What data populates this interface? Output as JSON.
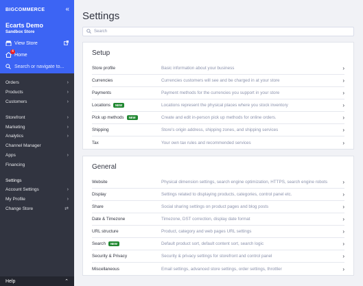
{
  "sidebar": {
    "brand": "BIGCOMMERCE",
    "store_name": "Ecarts Demo",
    "store_sub": "Sandbox Store",
    "view_store": "View Store",
    "home": "Home",
    "home_badge": "4",
    "search_placeholder": "Search or navigate to...",
    "nav": [
      {
        "label": "Orders"
      },
      {
        "label": "Products"
      },
      {
        "label": "Customers"
      },
      {
        "label": "Storefront"
      },
      {
        "label": "Marketing"
      },
      {
        "label": "Analytics"
      },
      {
        "label": "Channel Manager"
      },
      {
        "label": "Apps"
      },
      {
        "label": "Financing"
      },
      {
        "label": "Settings"
      },
      {
        "label": "Account Settings"
      },
      {
        "label": "My Profile"
      },
      {
        "label": "Change Store"
      }
    ],
    "help": "Help"
  },
  "main": {
    "title": "Settings",
    "search_placeholder": "Search",
    "setup": {
      "title": "Setup",
      "rows": [
        {
          "label": "Store profile",
          "desc": "Basic information about your business"
        },
        {
          "label": "Currencies",
          "desc": "Currencies customers will see and be charged in at your store"
        },
        {
          "label": "Payments",
          "desc": "Payment methods for the currencies you support in your store"
        },
        {
          "label": "Locations",
          "badge": "NEW",
          "desc": "Locations represent the physical places where you stock inventory"
        },
        {
          "label": "Pick up methods",
          "badge": "NEW",
          "desc": "Create and edit in-person pick up methods for online orders."
        },
        {
          "label": "Shipping",
          "desc": "Store's origin address, shipping zones, and shipping services"
        },
        {
          "label": "Tax",
          "desc": "Your own tax rules and recommended services"
        }
      ]
    },
    "general": {
      "title": "General",
      "rows": [
        {
          "label": "Website",
          "desc": "Physical dimension settings, search engine optimization, HTTPS, search engine robots"
        },
        {
          "label": "Display",
          "desc": "Settings related to displaying products, categories, control panel etc."
        },
        {
          "label": "Share",
          "desc": "Social sharing settings on product pages and blog posts"
        },
        {
          "label": "Date & Timezone",
          "desc": "Timezone, DST correction, display date format"
        },
        {
          "label": "URL structure",
          "desc": "Product, category and web pages URL settings"
        },
        {
          "label": "Search",
          "badge": "NEW",
          "desc": "Default product sort, default content sort, search logic"
        },
        {
          "label": "Security & Privacy",
          "desc": "Security & privacy settings for storefront and control panel"
        },
        {
          "label": "Miscellaneous",
          "desc": "Email settings, advanced store settings, order settings, throttler"
        }
      ]
    }
  },
  "colors": {
    "sidebar_top": "#3c64f4",
    "sidebar": "#313440",
    "badge": "#208831"
  }
}
